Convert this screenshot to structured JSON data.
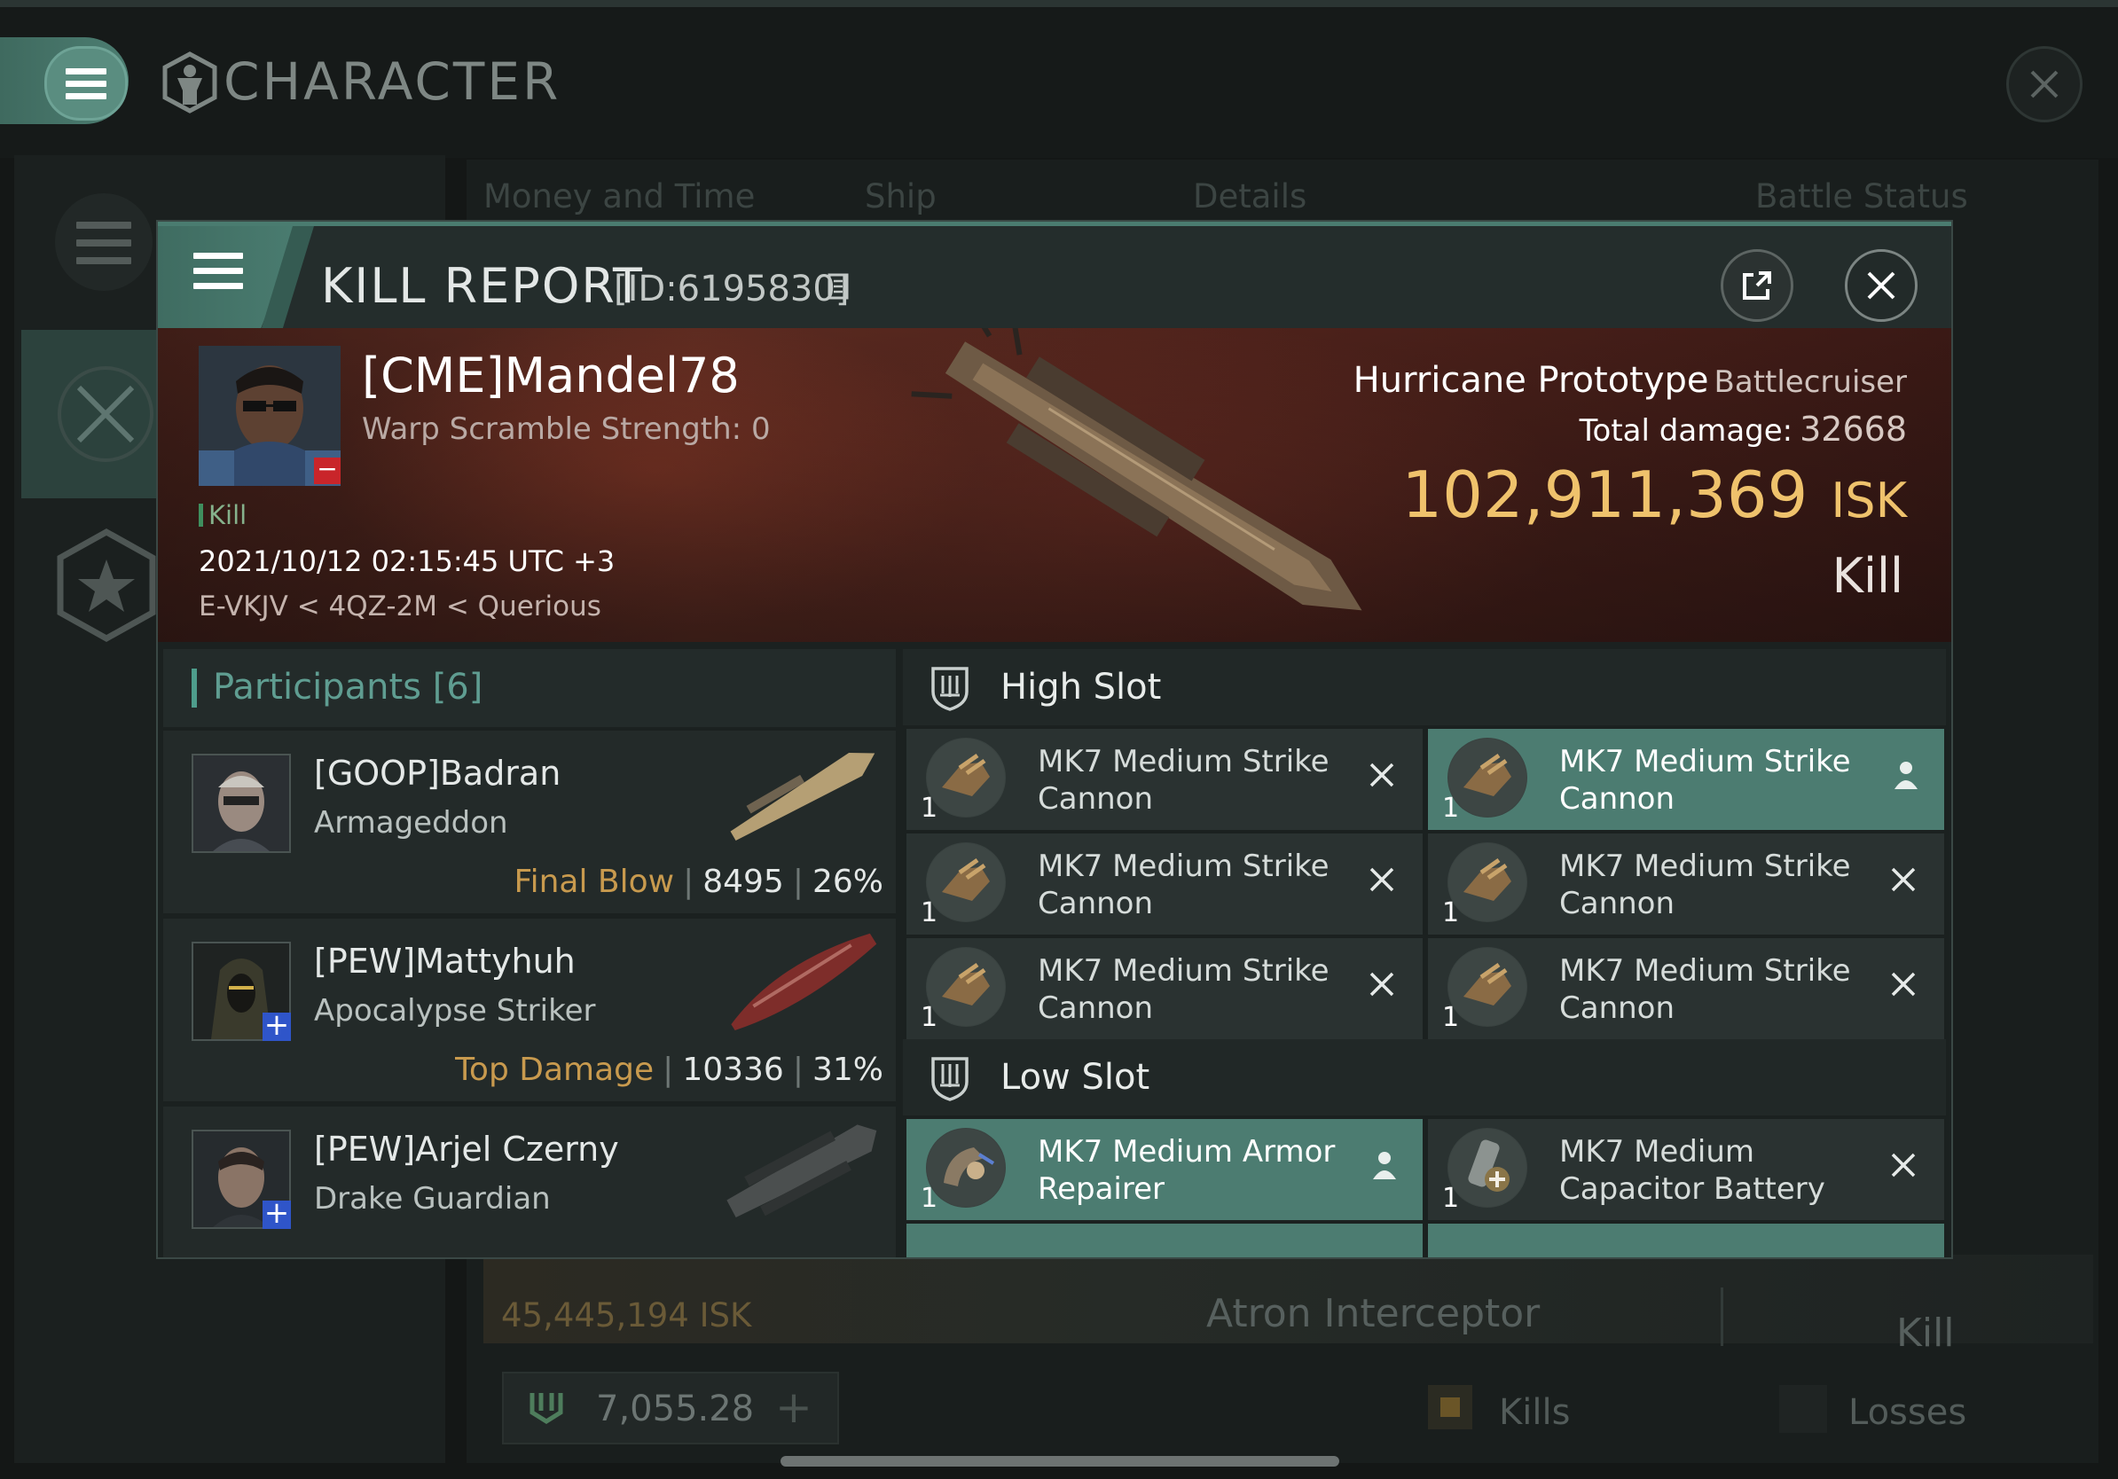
{
  "window": {
    "title": "CHARACTER"
  },
  "background": {
    "tabs": [
      "Money and Time",
      "Ship",
      "Details",
      "Battle Status"
    ],
    "row": {
      "isk": "45,445,194 ISK",
      "ship": "Atron Interceptor",
      "status": "Kill"
    },
    "bottom": {
      "value": "7,055.28",
      "kills_label": "Kills",
      "losses_label": "Losses"
    }
  },
  "report": {
    "title": "KILL REPORT",
    "id": "[ID:6195830]",
    "victim": {
      "name": "[CME]Mandel78",
      "warp_scramble": "Warp Scramble Strength: 0",
      "tag": "Kill",
      "datetime": "2021/10/12 02:15:45 UTC +3",
      "location": "E-VKJV < 4QZ-2M < Querious"
    },
    "ship": {
      "name": "Hurricane Prototype",
      "class": "Battlecruiser",
      "total_damage_label": "Total damage:",
      "total_damage": "32668",
      "isk_value": "102,911,369",
      "isk_unit": "ISK",
      "result": "Kill"
    },
    "participants": {
      "label": "Participants",
      "count": "[6]",
      "items": [
        {
          "name": "[GOOP]Badran",
          "ship": "Armageddon",
          "label": "Final Blow",
          "damage": "8495",
          "percent": "26%"
        },
        {
          "name": "[PEW]Mattyhuh",
          "ship": "Apocalypse Striker",
          "label": "Top Damage",
          "damage": "10336",
          "percent": "31%"
        },
        {
          "name": "[PEW]Arjel Czerny",
          "ship": "Drake Guardian",
          "label": "",
          "damage": "",
          "percent": ""
        }
      ]
    },
    "slots": {
      "high": {
        "label": "High Slot",
        "modules": [
          {
            "name": "MK7 Medium Strike Cannon",
            "qty": "1",
            "state": "destroyed"
          },
          {
            "name": "MK7 Medium Strike Cannon",
            "qty": "1",
            "state": "dropped"
          },
          {
            "name": "MK7 Medium Strike Cannon",
            "qty": "1",
            "state": "destroyed"
          },
          {
            "name": "MK7 Medium Strike Cannon",
            "qty": "1",
            "state": "destroyed"
          },
          {
            "name": "MK7 Medium Strike Cannon",
            "qty": "1",
            "state": "destroyed"
          },
          {
            "name": "MK7 Medium Strike Cannon",
            "qty": "1",
            "state": "destroyed"
          }
        ]
      },
      "low": {
        "label": "Low Slot",
        "modules": [
          {
            "name": "MK7 Medium Armor Repairer",
            "qty": "1",
            "state": "dropped"
          },
          {
            "name": "MK7 Medium Capacitor Battery",
            "qty": "1",
            "state": "destroyed"
          }
        ]
      }
    }
  },
  "colors": {
    "accent": "#4c7c71",
    "isk": "#efc26c",
    "label_gold": "#c89a4e",
    "badge_blue": "#2f55c9",
    "badge_red": "#c9252a"
  }
}
